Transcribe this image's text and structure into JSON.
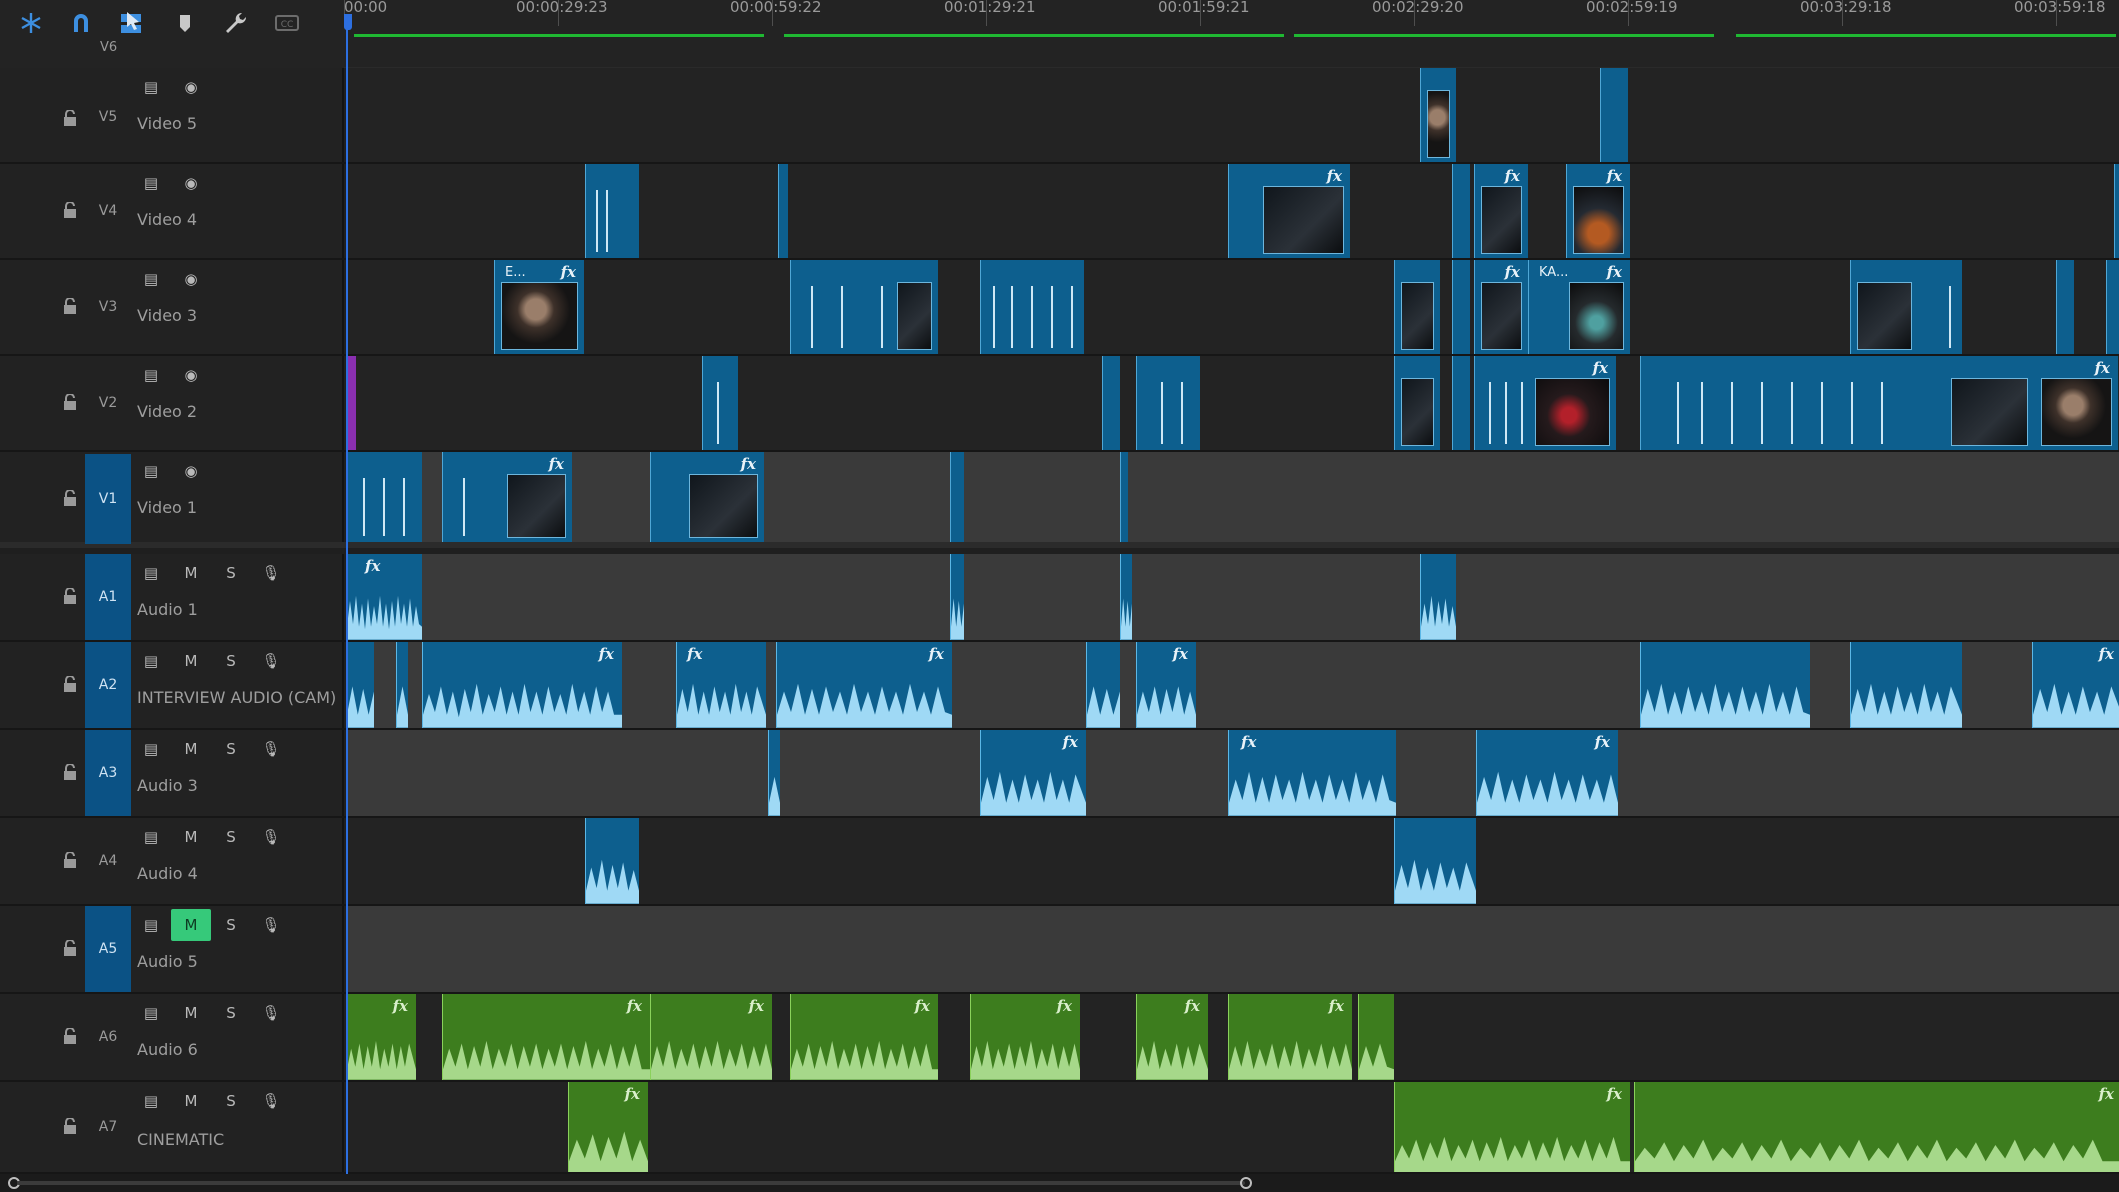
{
  "toolbar": {
    "icons": [
      "snap-icon",
      "magnet-icon",
      "linked-selection-icon",
      "marker-icon",
      "wrench-icon",
      "captions-icon"
    ]
  },
  "ruler": {
    "timecodes": [
      "00:00",
      "00:00:29:23",
      "00:00:59:22",
      "00:01:29:21",
      "00:01:59:21",
      "00:02:29:20",
      "00:02:59:19",
      "00:03:29:18",
      "00:03:59:18"
    ]
  },
  "tracks": {
    "v6": {
      "id": "V6"
    },
    "v5": {
      "id": "V5",
      "name": "Video 5"
    },
    "v4": {
      "id": "V4",
      "name": "Video 4"
    },
    "v3": {
      "id": "V3",
      "name": "Video 3"
    },
    "v2": {
      "id": "V2",
      "name": "Video 2"
    },
    "v1": {
      "id": "V1",
      "name": "Video 1"
    },
    "a1": {
      "id": "A1",
      "name": "Audio 1"
    },
    "a2": {
      "id": "A2",
      "name": "INTERVIEW AUDIO (CAM)"
    },
    "a3": {
      "id": "A3",
      "name": "Audio 3"
    },
    "a4": {
      "id": "A4",
      "name": "Audio 4"
    },
    "a5": {
      "id": "A5",
      "name": "Audio 5"
    },
    "a6": {
      "id": "A6",
      "name": "Audio 6"
    },
    "a7": {
      "id": "A7",
      "name": "CINEMATIC"
    }
  },
  "labels": {
    "mute": "M",
    "solo": "S",
    "fx": "fx",
    "clip_e": "E...",
    "clip_ka": "KA..."
  },
  "colors": {
    "video_clip": "#0d5f8e",
    "audio_clip": "#0d5f8e",
    "music_clip": "#3d7d1e",
    "playhead": "#2d6fe0",
    "render_bar": "#1fb832",
    "mute_active": "#36c97a",
    "track_target": "#0b5285"
  }
}
